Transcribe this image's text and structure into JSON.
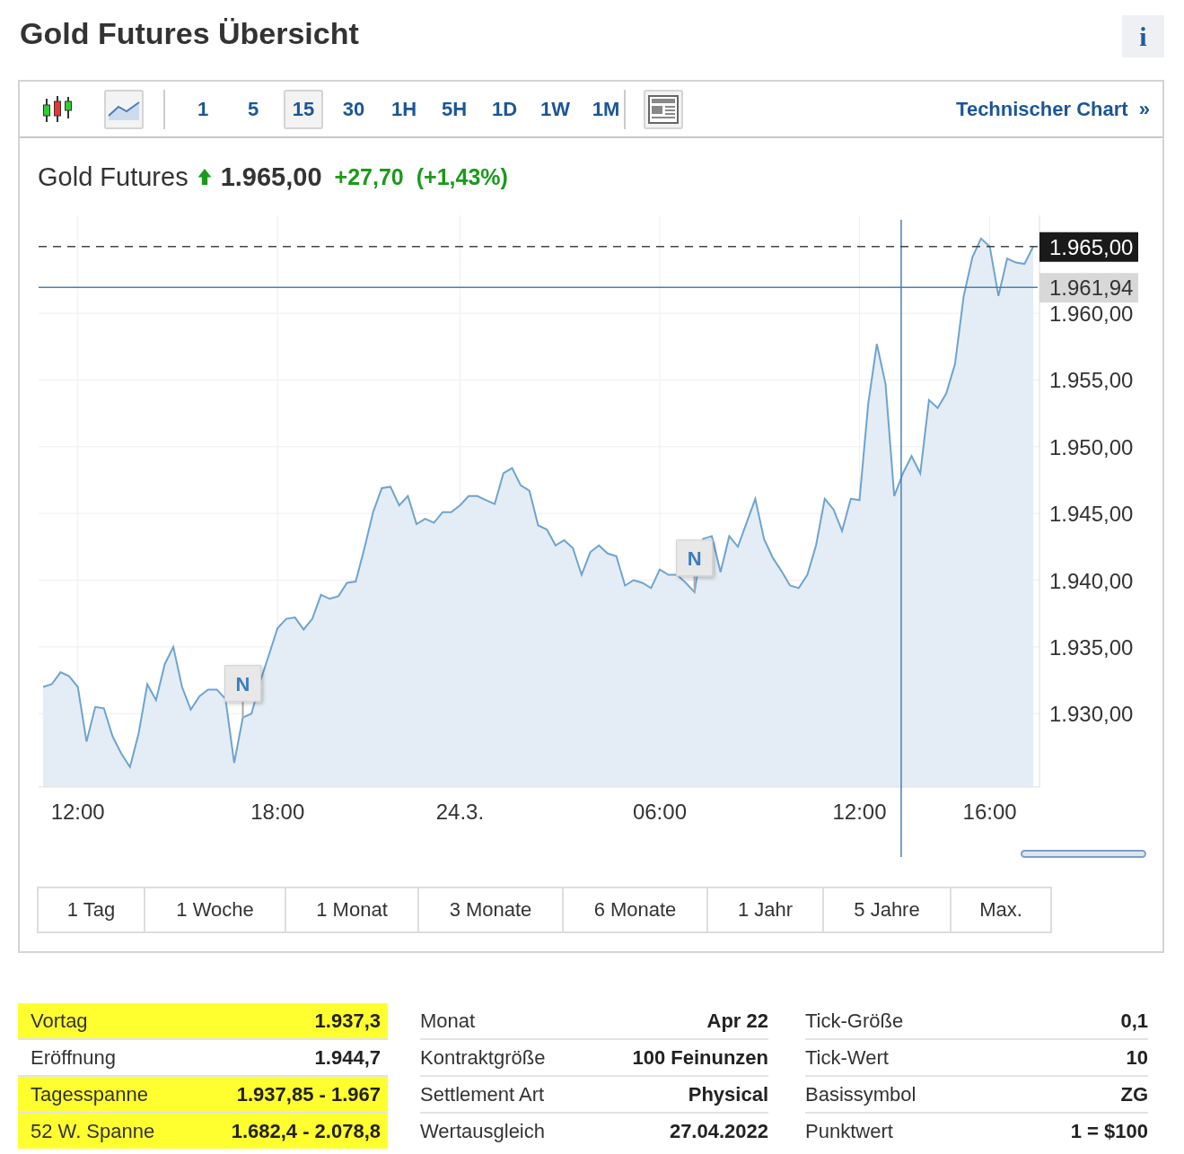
{
  "page_title": "Gold Futures Übersicht",
  "info_button": "i",
  "toolbar": {
    "chart_types": [
      {
        "kind": "candles",
        "selected": false
      },
      {
        "kind": "area",
        "selected": true
      }
    ],
    "intervals": [
      {
        "label": "1",
        "selected": false
      },
      {
        "label": "5",
        "selected": false
      },
      {
        "label": "15",
        "selected": true
      },
      {
        "label": "30",
        "selected": false
      },
      {
        "label": "1H",
        "selected": false
      },
      {
        "label": "5H",
        "selected": false
      },
      {
        "label": "1D",
        "selected": false
      },
      {
        "label": "1W",
        "selected": false
      },
      {
        "label": "1M",
        "selected": false
      }
    ],
    "technical_chart_link": "Technischer Chart",
    "link_arrow": "»"
  },
  "quote": {
    "name": "Gold Futures",
    "price": "1.965,00",
    "change": "+27,70",
    "change_percent": "(+1,43%)"
  },
  "chart_data": {
    "type": "area",
    "grid": true,
    "ylim": [
      1924.5,
      1967
    ],
    "yticks": [
      {
        "value": 1930,
        "label": "1.930,00"
      },
      {
        "value": 1935,
        "label": "1.935,00"
      },
      {
        "value": 1940,
        "label": "1.940,00"
      },
      {
        "value": 1945,
        "label": "1.945,00"
      },
      {
        "value": 1950,
        "label": "1.950,00"
      },
      {
        "value": 1955,
        "label": "1.955,00"
      },
      {
        "value": 1960,
        "label": "1.960,00"
      }
    ],
    "categories": [
      null,
      null,
      null,
      null,
      "12:00",
      null,
      null,
      null,
      null,
      null,
      null,
      null,
      null,
      null,
      null,
      null,
      null,
      null,
      null,
      null,
      null,
      null,
      null,
      null,
      null,
      null,
      null,
      "18:00",
      null,
      null,
      null,
      null,
      null,
      null,
      null,
      null,
      null,
      null,
      null,
      null,
      null,
      null,
      null,
      null,
      null,
      null,
      null,
      null,
      "24.3.",
      null,
      null,
      null,
      null,
      null,
      null,
      null,
      null,
      null,
      null,
      null,
      null,
      null,
      null,
      null,
      null,
      null,
      null,
      null,
      null,
      null,
      null,
      "06:00",
      null,
      null,
      null,
      null,
      null,
      null,
      null,
      null,
      null,
      null,
      null,
      null,
      null,
      null,
      null,
      null,
      null,
      null,
      null,
      null,
      null,
      null,
      "12:00",
      null,
      null,
      null,
      null,
      null,
      null,
      null,
      null,
      null,
      null,
      null,
      null,
      null,
      null,
      "16:00",
      null,
      null,
      null,
      null,
      null
    ],
    "series": [
      {
        "color": "#6fa3cf",
        "values": [
          1932.0,
          1932.2,
          1933.1,
          1932.8,
          1932.0,
          1927.9,
          1930.5,
          1930.4,
          1928.3,
          1927.0,
          1926.0,
          1928.5,
          1932.2,
          1931.0,
          1933.7,
          1935.0,
          1932.0,
          1930.3,
          1931.3,
          1931.8,
          1931.8,
          1931.1,
          1926.3,
          1929.7,
          1930.0,
          1932.4,
          1934.4,
          1936.4,
          1937.1,
          1937.2,
          1936.3,
          1937.1,
          1938.9,
          1938.6,
          1938.8,
          1939.8,
          1939.9,
          1942.4,
          1945.1,
          1946.9,
          1947.0,
          1945.6,
          1946.3,
          1944.2,
          1944.6,
          1944.3,
          1945.1,
          1945.1,
          1945.6,
          1946.3,
          1946.3,
          1946.0,
          1945.7,
          1948.0,
          1948.4,
          1947.1,
          1946.7,
          1944.1,
          1943.8,
          1942.6,
          1943.0,
          1942.4,
          1940.4,
          1942.1,
          1942.6,
          1942.0,
          1941.8,
          1939.6,
          1940.0,
          1939.8,
          1939.4,
          1940.8,
          1940.4,
          1940.4,
          1939.8,
          1939.1,
          1943.1,
          1943.3,
          1940.6,
          1943.3,
          1942.5,
          1944.3,
          1946.1,
          1943.1,
          1941.7,
          1940.7,
          1939.6,
          1939.4,
          1940.4,
          1942.6,
          1946.1,
          1945.3,
          1943.7,
          1946.1,
          1946.0,
          1953.2,
          1957.7,
          1954.7,
          1946.3,
          1948.0,
          1949.3,
          1948.0,
          1953.5,
          1952.9,
          1954.0,
          1956.2,
          1961.3,
          1964.2,
          1965.6,
          1965.0,
          1961.3,
          1964.1,
          1963.8,
          1963.7,
          1965.0
        ]
      }
    ],
    "ref_lines": [
      {
        "axis": "y",
        "value": 1965,
        "label": "1.965,00"
      },
      {
        "axis": "y",
        "value": 1961.94,
        "label": "1.961,94"
      }
    ],
    "annotations": [
      {
        "text": "N",
        "y": 1929.7
      },
      {
        "text": "N",
        "y": 1939.1
      }
    ]
  },
  "ranges": [
    "1 Tag",
    "1 Woche",
    "1 Monat",
    "3 Monate",
    "6 Monate",
    "1 Jahr",
    "5 Jahre",
    "Max."
  ],
  "details": [
    [
      {
        "label": "Vortag",
        "value": "1.937,3",
        "highlighted": true
      },
      {
        "label": "Eröffnung",
        "value": "1.944,7",
        "highlighted": false
      },
      {
        "label": "Tagesspanne",
        "value": "1.937,85 - 1.967",
        "highlighted": true
      },
      {
        "label": "52 W. Spanne",
        "value": "1.682,4 - 2.078,8",
        "highlighted": true
      }
    ],
    [
      {
        "label": "Monat",
        "value": "Apr 22",
        "highlighted": false
      },
      {
        "label": "Kontraktgröße",
        "value": "100 Feinunzen",
        "highlighted": false
      },
      {
        "label": "Settlement Art",
        "value": "Physical",
        "highlighted": false
      },
      {
        "label": "Wertausgleich",
        "value": "27.04.2022",
        "highlighted": false
      }
    ],
    [
      {
        "label": "Tick-Größe",
        "value": "0,1",
        "highlighted": false
      },
      {
        "label": "Tick-Wert",
        "value": "10",
        "highlighted": false
      },
      {
        "label": "Basissymbol",
        "value": "ZG",
        "highlighted": false
      },
      {
        "label": "Punktwert",
        "value": "1 = $100",
        "highlighted": false
      }
    ]
  ]
}
